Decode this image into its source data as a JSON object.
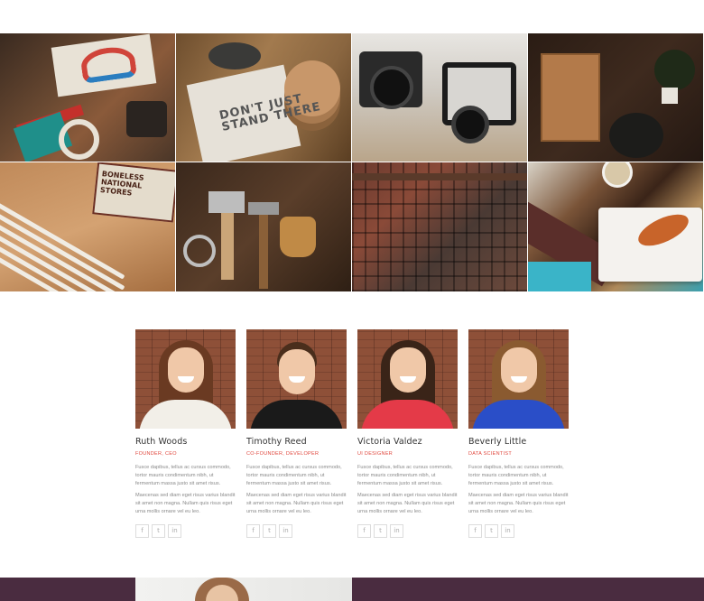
{
  "portfolio": {
    "tiles": [
      {
        "icon": "design-desk-photo"
      },
      {
        "icon": "notebook-coasters-photo",
        "text": "DON'T JUST STAND THERE"
      },
      {
        "icon": "vintage-cameras-photo"
      },
      {
        "icon": "kitchen-table-photo"
      },
      {
        "icon": "pencils-sign-photo",
        "text": "BONELESS NATIONAL STORES"
      },
      {
        "icon": "workshop-tools-photo"
      },
      {
        "icon": "letterpress-type-photo"
      },
      {
        "icon": "plated-food-photo"
      }
    ]
  },
  "team": {
    "members": [
      {
        "name": "Ruth Woods",
        "role": "FOUNDER, CEO",
        "bio1": "Fusce dapibus, tellus ac cursus commodo, tortor mauris condimentum nibh, ut fermentum massa justo sit amet risus.",
        "bio2": "Maecenas sed diam eget risus varius blandit sit amet non magna. Nullam quis risus eget urna mollis ornare vel eu leo.",
        "hair": "#6a3a22",
        "top": "#f2efe8"
      },
      {
        "name": "Timothy Reed",
        "role": "CO-FOUNDER, DEVELOPER",
        "bio1": "Fusce dapibus, tellus ac cursus commodo, tortor mauris condimentum nibh, ut fermentum massa justo sit amet risus.",
        "bio2": "Maecenas sed diam eget risus varius blandit sit amet non magna. Nullam quis risus eget urna mollis ornare vel eu leo.",
        "hair": "#4a2e1c",
        "top": "#1a1a1a"
      },
      {
        "name": "Victoria Valdez",
        "role": "UI DESIGNER",
        "bio1": "Fusce dapibus, tellus ac cursus commodo, tortor mauris condimentum nibh, ut fermentum massa justo sit amet risus.",
        "bio2": "Maecenas sed diam eget risus varius blandit sit amet non magna. Nullam quis risus eget urna mollis ornare vel eu leo.",
        "hair": "#3a2418",
        "top": "#e43a48"
      },
      {
        "name": "Beverly Little",
        "role": "DATA SCIENTIST",
        "bio1": "Fusce dapibus, tellus ac cursus commodo, tortor mauris condimentum nibh, ut fermentum massa justo sit amet risus.",
        "bio2": "Maecenas sed diam eget risus varius blandit sit amet non magna. Nullam quis risus eget urna mollis ornare vel eu leo.",
        "hair": "#8a5a30",
        "top": "#2a4ec8"
      }
    ],
    "socials": [
      {
        "icon": "facebook-icon",
        "glyph": "f"
      },
      {
        "icon": "twitter-icon",
        "glyph": "t"
      },
      {
        "icon": "linkedin-icon",
        "glyph": "in"
      }
    ]
  },
  "colors": {
    "accent": "#e0463c",
    "band": "#4a2c40"
  }
}
